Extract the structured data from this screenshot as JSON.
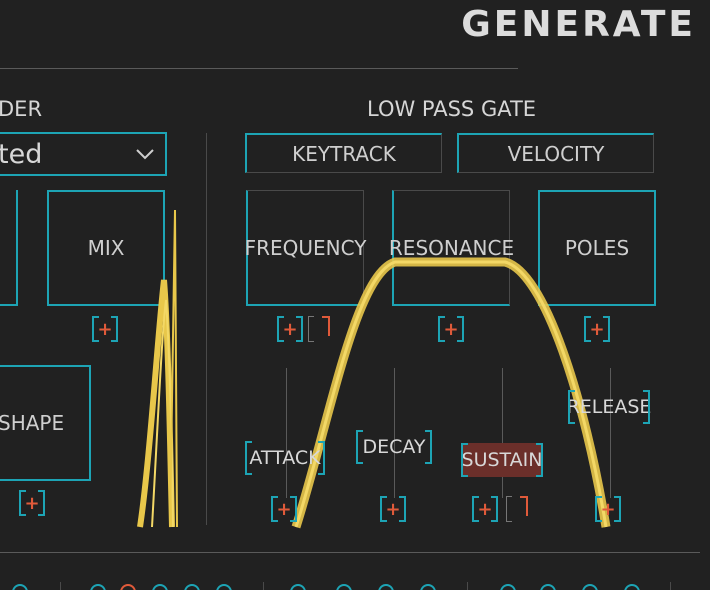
{
  "header": {
    "title": "GENERATE"
  },
  "left_section": {
    "label": "DER",
    "dropdown_value": "ted",
    "mix_label": "MIX",
    "shape_label": "SHAPE",
    "mod_symbol": "+"
  },
  "low_pass_gate": {
    "label": "LOW PASS GATE",
    "keytrack_label": "KEYTRACK",
    "velocity_label": "VELOCITY",
    "frequency_label": "FREQUENCY",
    "resonance_label": "RESONANCE",
    "poles_label": "POLES",
    "attack_label": "ATTACK",
    "decay_label": "DECAY",
    "sustain_label": "SUSTAIN",
    "release_label": "RELEASE"
  },
  "colors": {
    "accent": "#1da4b5",
    "mod_plus": "#e05a3a",
    "waveform": "#e8c74a",
    "background": "#212121"
  }
}
